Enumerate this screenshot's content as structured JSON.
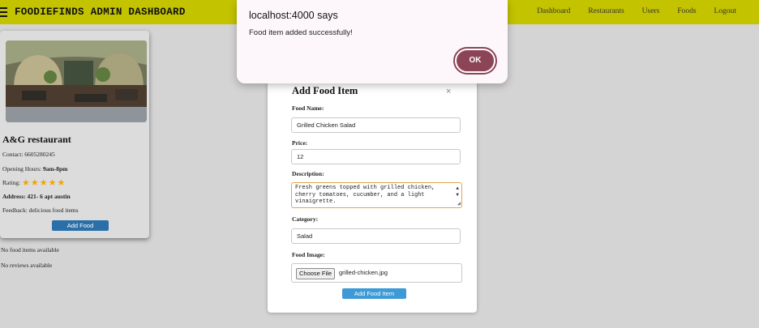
{
  "header": {
    "brand": "FOODIEFINDS ADMIN DASHBOARD",
    "nav": [
      "Dashboard",
      "Restaurants",
      "Users",
      "Foods",
      "Logout"
    ]
  },
  "restaurant": {
    "name": "A&G restaurant",
    "contact_label": "Contact:",
    "contact": "6605280245",
    "hours_label": "Opening Hours:",
    "hours": "9am-8pm",
    "rating_label": "Rating:",
    "rating": 5,
    "address_label": "Address:",
    "address": "421- 6 apt austin",
    "feedback_label": "Feedback:",
    "feedback": "delicious food items",
    "add_food_label": "Add Food"
  },
  "status": {
    "no_food": "No food items available",
    "no_reviews": "No reviews available"
  },
  "modal": {
    "title": "Add Food Item",
    "close_glyph": "×",
    "food_name_label": "Food Name:",
    "food_name": "Grilled Chicken Salad",
    "price_label": "Price:",
    "price": "12",
    "description_label": "Description:",
    "description": "Fresh greens topped with grilled chicken, cherry tomatoes, cucumber, and a light vinaigrette.",
    "category_label": "Category:",
    "category": "Salad",
    "image_label": "Food Image:",
    "choose_file_label": "Choose File",
    "file_name": "grilled-chicken.jpg",
    "submit_label": "Add Food Item"
  },
  "alert": {
    "title": "localhost:4000 says",
    "message": "Food item added successfully!",
    "ok_label": "OK"
  },
  "colors": {
    "header_bg": "#c3c300",
    "add_food_btn": "#2a6fa8",
    "submit_btn": "#3d9ad6",
    "ok_btn": "#8c4457",
    "star": "#f0a500"
  },
  "icons": [
    "hamburger-menu-icon",
    "close-icon",
    "star-icon"
  ]
}
